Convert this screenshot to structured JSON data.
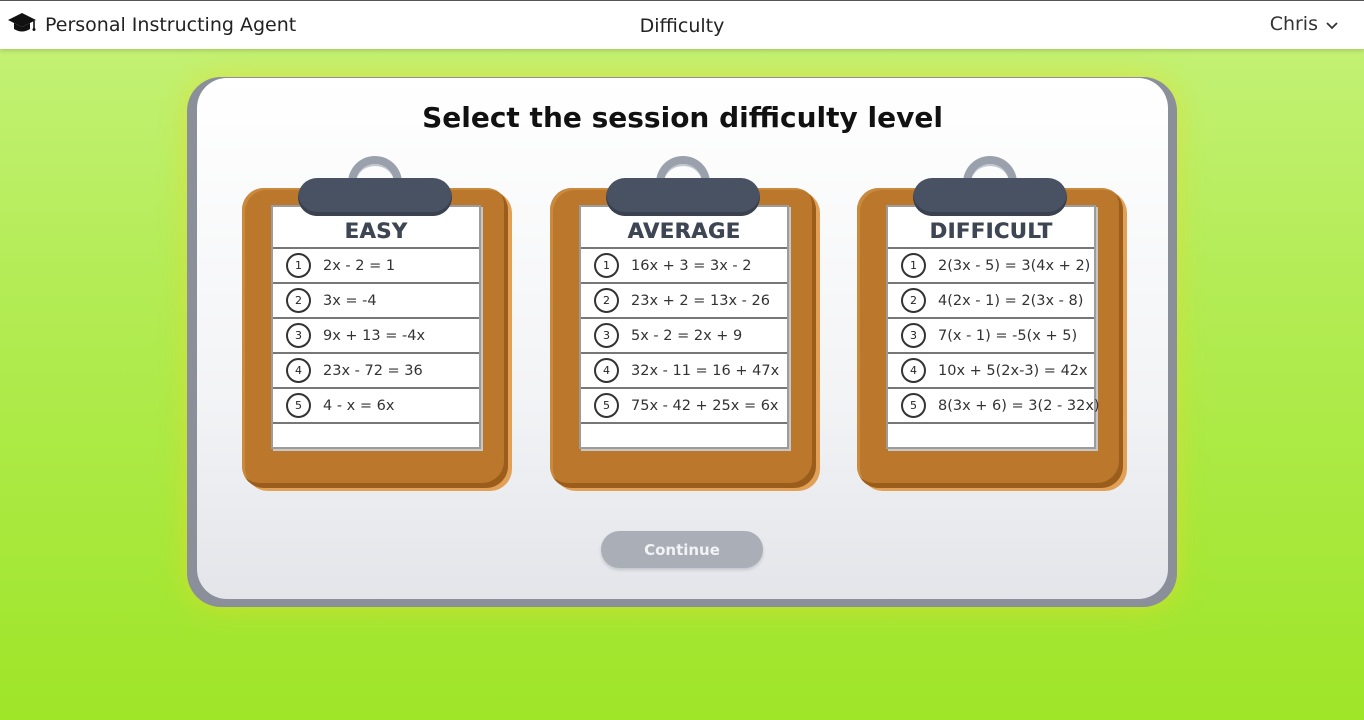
{
  "header": {
    "brand": "Personal Instructing Agent",
    "brand_icon": "graduation-cap-icon",
    "page_title": "Difficulty",
    "user_name": "Chris",
    "user_menu_icon": "chevron-down-icon"
  },
  "main": {
    "heading": "Select the session difficulty level",
    "continue_label": "Continue"
  },
  "levels": [
    {
      "title": "EASY",
      "items": [
        {
          "n": "1",
          "eq": "2x - 2 = 1"
        },
        {
          "n": "2",
          "eq": "3x = -4"
        },
        {
          "n": "3",
          "eq": "9x + 13 = -4x"
        },
        {
          "n": "4",
          "eq": "23x - 72 = 36"
        },
        {
          "n": "5",
          "eq": "4 - x = 6x"
        }
      ]
    },
    {
      "title": "AVERAGE",
      "items": [
        {
          "n": "1",
          "eq": "16x + 3 = 3x - 2"
        },
        {
          "n": "2",
          "eq": "23x + 2 = 13x - 26"
        },
        {
          "n": "3",
          "eq": "5x - 2 = 2x + 9"
        },
        {
          "n": "4",
          "eq": "32x - 11 = 16 + 47x"
        },
        {
          "n": "5",
          "eq": "75x - 42 + 25x = 6x"
        }
      ]
    },
    {
      "title": "DIFFICULT",
      "items": [
        {
          "n": "1",
          "eq": "2(3x - 5) = 3(4x + 2)"
        },
        {
          "n": "2",
          "eq": "4(2x - 1) = 2(3x - 8)"
        },
        {
          "n": "3",
          "eq": "7(x - 1) = -5(x + 5)"
        },
        {
          "n": "4",
          "eq": "10x + 5(2x-3) = 42x"
        },
        {
          "n": "5",
          "eq": "8(3x + 6) = 3(2 - 32x)"
        }
      ]
    }
  ],
  "colors": {
    "background_top": "#c6f27a",
    "background_bottom": "#9fe528",
    "board": "#bb782d",
    "clip": "#495262",
    "button_disabled": "#a9aeb7"
  }
}
